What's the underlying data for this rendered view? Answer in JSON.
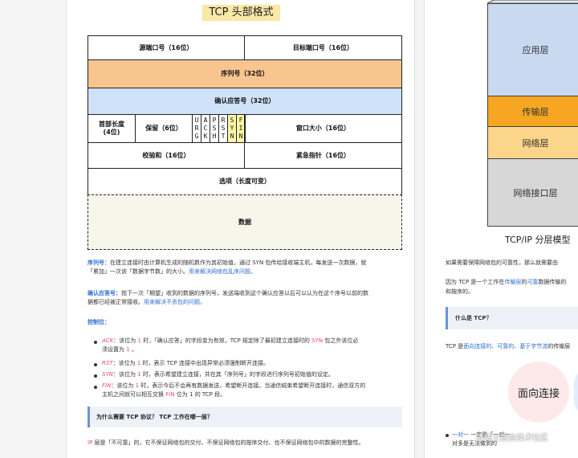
{
  "diagram": {
    "title": "TCP 头部格式",
    "row1": {
      "src_port": "源端口号（16位）",
      "dst_port": "目标端口号（16位）"
    },
    "seq": "序列号（32位）",
    "ack": "确认应答号（32位）",
    "row4": {
      "header_len_line1": "首部长度",
      "header_len_line2": "(4位)",
      "reserved": "保留（6位）",
      "flags": [
        {
          "chars": [
            "U",
            "R",
            "G"
          ],
          "highlight": false
        },
        {
          "chars": [
            "A",
            "C",
            "K"
          ],
          "highlight": false
        },
        {
          "chars": [
            "P",
            "S",
            "H"
          ],
          "highlight": false
        },
        {
          "chars": [
            "R",
            "S",
            "T"
          ],
          "highlight": false
        },
        {
          "chars": [
            "S",
            "Y",
            "N"
          ],
          "highlight": true
        },
        {
          "chars": [
            "F",
            "I",
            "N"
          ],
          "highlight": true
        }
      ],
      "window": "窗口大小（16位）"
    },
    "row5": {
      "checksum": "校验和（16位）",
      "urgent": "紧急指针（16位）"
    },
    "options": "选项（长度可变）",
    "data": "数据",
    "colors": {
      "seq_fill": "#f8c58f",
      "ack_fill": "#cfe2f7",
      "data_fill": "#f7f6ea",
      "title_bg": "#fbe7a6"
    }
  },
  "text": {
    "seq_label": "序列号：",
    "seq_line1": "在建立连接时由计算机生成的随机数作为其初始值，通过 SYN 包传给接收端主机，每发送一次数据，就",
    "seq_line2a": "「累加」一次该「数据字节数」的大小。",
    "seq_line2b": "用来解决网络包乱序问题。",
    "ack_label": "确认应答号：",
    "ack_line1": "指下一次「期望」收到的数据的序列号，发送端收到这个确认应答以后可以认为在这个序号以前的数",
    "ack_line2a": "据都已经被正常接收。",
    "ack_line2b": "用来解决不丢包的问题。",
    "ctrl_label": "控制位：",
    "ack_item_name": "ACK",
    "ack_item_1": "：该位为",
    "ack_item_one": "1",
    "ack_item_2": "时，「确认应答」的字段变为有效，TCP 规定除了最初建立连接时的",
    "ack_item_syn": "SYN",
    "ack_item_3": "包之外该位必",
    "ack_item_4": "须设置为",
    "ack_item_one2": "1",
    "ack_item_5": "。",
    "rst_item_name": "RST",
    "rst_item_1": "：该位为",
    "rst_item_one": "1",
    "rst_item_2": "时，表示 TCP 连接中出现异常必须强制断开连接。",
    "syn_item_name": "SYN",
    "syn_item_1": "：该位为",
    "syn_item_one": "1",
    "syn_item_2": "时，表示希望建立连接，并在其「序列号」的字段进行序列号初始值的设定。",
    "fin_item_name": "FIN",
    "fin_item_1": "：该位为",
    "fin_item_one": "1",
    "fin_item_2": "时，表示今后不会再有数据发送，希望断开连接。当通信结束希望断开连接时，通信双方的",
    "fin_item_3": "主机之间就可以相互交换",
    "fin_item_fin": "FIN",
    "fin_item_4": "位为 1 的 TCP 段。",
    "note_q": "为什么需要 TCP 协议？ TCP 工作在哪一层？",
    "ip_name": "IP",
    "ip_text": "层是「不可靠」的，它不保证网络包的交付、不保证网络包的按序交付、也不保证网络包中的数据的完整性。"
  },
  "right": {
    "layers": [
      {
        "label": "应用层",
        "color": "#c9d9f0"
      },
      {
        "label": "传输层",
        "color": "#f6a623"
      },
      {
        "label": "网络层",
        "color": "#fbd58a"
      },
      {
        "label": "网络接口层",
        "color": "#d7d7d7"
      }
    ],
    "caption": "TCP/IP 分层模型",
    "line1": "如果需要保障网络包的可靠性，那么就需要由",
    "line2a": "因为 TCP 是一个工作在",
    "line2b": "传输层",
    "line2c": "的",
    "line2d": "可靠",
    "line2e": "数据传输的",
    "line3": "和按序的。",
    "note_q": "什么是 TCP？",
    "line4a": "TCP 是",
    "line4b": "面向连接的、可靠的、基于字节流",
    "line4c": "的传输层",
    "circle_label": "面向连接",
    "footer_a": "一对一",
    "footer_b": "对多是无法做到的",
    "footer_c": "一定是「一对一",
    "watermark": "@稀土掘金技术社区"
  }
}
